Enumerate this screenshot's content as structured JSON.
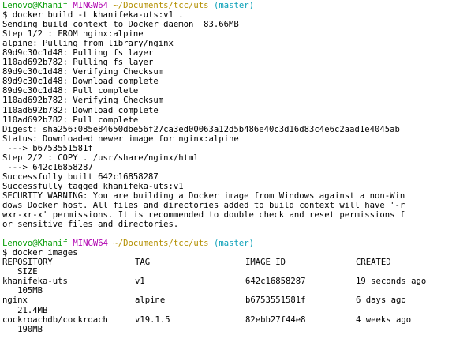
{
  "colors": {
    "prompt_user": "#0a9e0a",
    "prompt_system": "#b000b0",
    "prompt_path": "#b38f00",
    "prompt_branch": "#0aa0b8",
    "text": "#000000",
    "background": "#ffffff"
  },
  "session1": {
    "prompt": {
      "user": "Lenovo@Khanif",
      "system": "MINGW64",
      "path": "~/Documents/tcc/uts",
      "branch": "(master)"
    },
    "command": "$ docker build -t khanifeka-uts:v1 .",
    "output": [
      "Sending build context to Docker daemon  83.66MB",
      "Step 1/2 : FROM nginx:alpine",
      "alpine: Pulling from library/nginx",
      "89d9c30c1d48: Pulling fs layer",
      "110ad692b782: Pulling fs layer",
      "89d9c30c1d48: Verifying Checksum",
      "89d9c30c1d48: Download complete",
      "89d9c30c1d48: Pull complete",
      "110ad692b782: Verifying Checksum",
      "110ad692b782: Download complete",
      "110ad692b782: Pull complete",
      "Digest: sha256:085e84650dbe56f27ca3ed00063a12d5b486e40c3d16d83c4e6c2aad1e4045ab",
      "Status: Downloaded newer image for nginx:alpine",
      " ---> b6753551581f",
      "Step 2/2 : COPY . /usr/share/nginx/html",
      " ---> 642c16858287",
      "Successfully built 642c16858287",
      "Successfully tagged khanifeka-uts:v1",
      "SECURITY WARNING: You are building a Docker image from Windows against a non-Win",
      "dows Docker host. All files and directories added to build context will have '-r",
      "wxr-xr-x' permissions. It is recommended to double check and reset permissions f",
      "or sensitive files and directories."
    ]
  },
  "session2": {
    "prompt": {
      "user": "Lenovo@Khanif",
      "system": "MINGW64",
      "path": "~/Documents/tcc/uts",
      "branch": "(master)"
    },
    "command": "$ docker images",
    "table": {
      "headers": [
        "REPOSITORY",
        "TAG",
        "IMAGE ID",
        "CREATED"
      ],
      "header_wrap": "   SIZE",
      "rows": [
        {
          "repository": "khanifeka-uts",
          "tag": "v1",
          "image_id": "642c16858287",
          "created": "19 seconds ago",
          "size": "   105MB"
        },
        {
          "repository": "nginx",
          "tag": "alpine",
          "image_id": "b6753551581f",
          "created": "6 days ago",
          "size": "   21.4MB"
        },
        {
          "repository": "cockroachdb/cockroach",
          "tag": "v19.1.5",
          "image_id": "82ebb27f44e8",
          "created": "4 weeks ago",
          "size": "   190MB"
        }
      ]
    }
  }
}
